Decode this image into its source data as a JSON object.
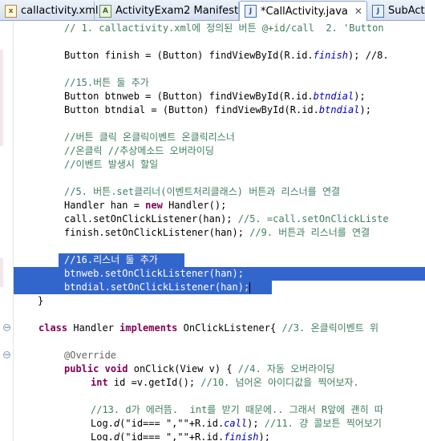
{
  "tabs": [
    {
      "label": "callactivity.xml",
      "icon": "xml-file-icon",
      "active": false
    },
    {
      "label": "ActivityExam2 Manifest",
      "icon": "manifest-file-icon",
      "active": false
    },
    {
      "label": "*CallActivity.java",
      "icon": "java-file-icon",
      "active": true
    },
    {
      "label": "SubActiv",
      "icon": "java-file-icon",
      "active": false
    }
  ],
  "close_glyph": "✕",
  "code": {
    "l01_comment": "// 1. callactivity.xml에 정의된 버튼 @+id/call  2. 'Button",
    "l02_a": "Button finish = (Button) findViewById(R.id.",
    "l02_b": "finish",
    "l02_c": "); //8.",
    "l03": "//15.버튼 둘 추가",
    "l04_a": "Button btnweb = (Button) findViewById(R.id.",
    "l04_b": "btndial",
    "l04_c": ");",
    "l05_a": "Button btndial = (Button) findViewById(R.id.",
    "l05_b": "btndial",
    "l05_c": ");",
    "l06": "//버튼 클릭 온클릭이벤트 온클릭리스너",
    "l07": "//온클릭 //추상메소드 오버라이딩",
    "l08": "//이벤트 발생시 할일",
    "l09": "//5. 버튼.set클리너(이벤트처리클래스) 버튼과 리스너를 연결",
    "l10_a": "Handler han = ",
    "l10_kw": "new",
    "l10_b": " Handler();",
    "l11_a": "call.setOnClickListener(han); ",
    "l11_c": "//5. =call.setOnClickListe",
    "l12_a": "finish.setOnClickListener(han); ",
    "l12_c": "//9. 버튼과 리스너를 연결",
    "l13": "//16.리스너 둘 추가",
    "l14": "btnweb.setOnClickListener(han);",
    "l15": "btndial.setOnClickListener(han);",
    "l16": "}",
    "l17_kw1": "class",
    "l17_a": " Handler ",
    "l17_kw2": "implements",
    "l17_b": " OnClickListener{ ",
    "l17_c": "//3. 온클릭이벤트 위",
    "l18": "@Override",
    "l19_kw1": "public",
    "l19_kw2": "void",
    "l19_a": " onClick(View v) { ",
    "l19_c": "//4. 자동 오버라이딩",
    "l20_kw": "int",
    "l20_a": " id =v.getId(); ",
    "l20_c": "//10. 넘어온 아이디값을 찍어보자.",
    "l21": "//13. d가 에러뜸.  int를 받기 때문에.. 그래서 R앞에 괜히 따",
    "l22_a": "Log.",
    "l22_b": "d",
    "l22_c": "(\"id=== \",\"\"+R.id.",
    "l22_d": "call",
    "l22_e": "); ",
    "l22_f": "//11. 걍 콜보튼 찍어보기",
    "l23_a": "Log.",
    "l23_b": "d",
    "l23_c": "(\"id=== \",\"\"+R.id.",
    "l23_d": "finish",
    "l23_e": ");"
  }
}
